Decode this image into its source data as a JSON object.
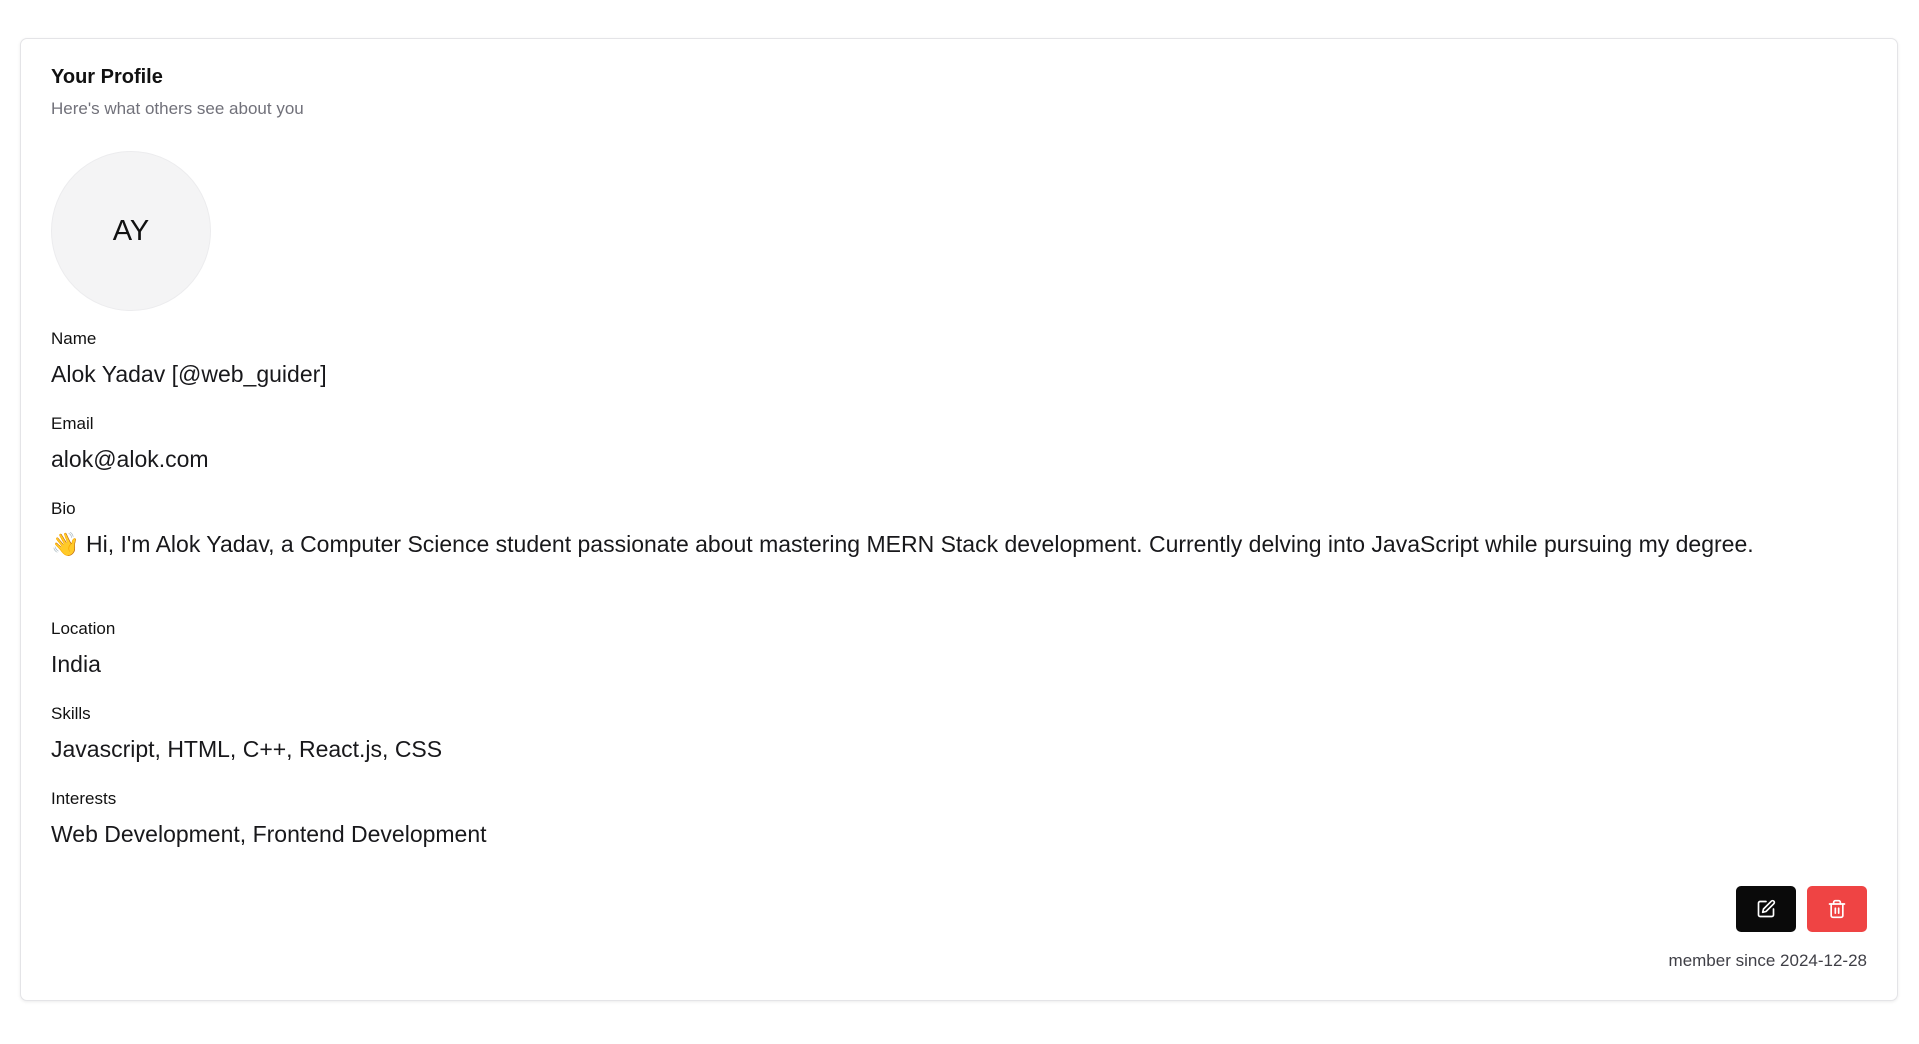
{
  "profile": {
    "title": "Your Profile",
    "subtitle": "Here's what others see about you",
    "avatar_initials": "AY",
    "fields": {
      "name": {
        "label": "Name",
        "value": "Alok Yadav [@web_guider]"
      },
      "email": {
        "label": "Email",
        "value": "alok@alok.com"
      },
      "bio": {
        "label": "Bio",
        "value": "👋 Hi, I'm Alok Yadav, a Computer Science student passionate about mastering MERN Stack development. Currently delving into JavaScript while pursuing my degree."
      },
      "location": {
        "label": "Location",
        "value": "India"
      },
      "skills": {
        "label": "Skills",
        "value": "Javascript, HTML, C++, React.js, CSS"
      },
      "interests": {
        "label": "Interests",
        "value": "Web Development, Frontend Development"
      }
    },
    "actions": {
      "edit_icon": "edit-icon",
      "delete_icon": "trash-icon"
    },
    "member_since_label": "member since",
    "member_since_date": "2024-12-28"
  },
  "colors": {
    "edit_button": "#0a0a0a",
    "delete_button": "#ef4444",
    "avatar_bg": "#f4f4f5",
    "subtitle": "#71717a"
  }
}
